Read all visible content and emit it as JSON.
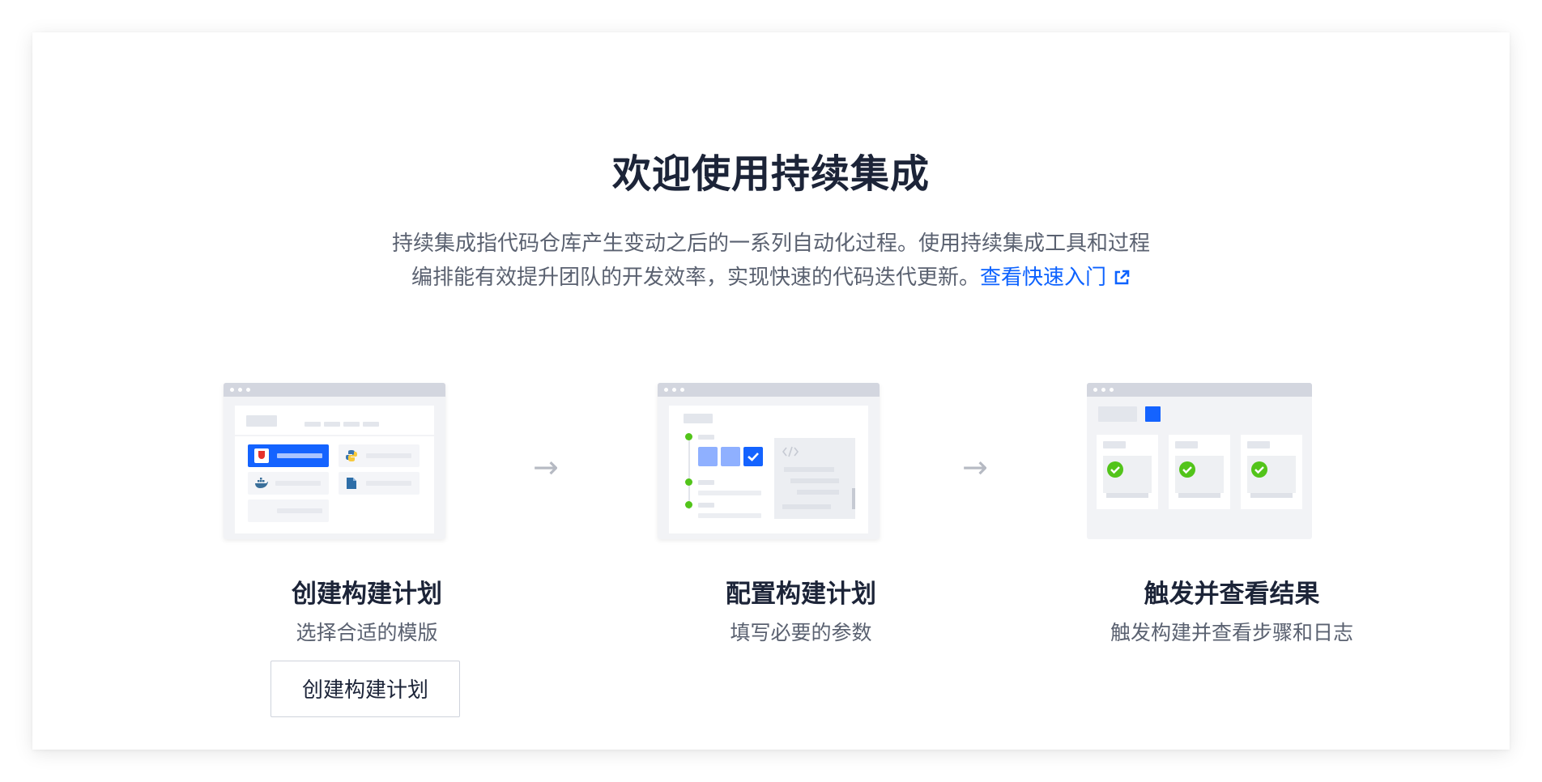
{
  "header": {
    "title": "欢迎使用持续集成",
    "description_line1": "持续集成指代码仓库产生变动之后的一系列自动化过程。使用持续集成工具和过程",
    "description_line2": "编排能有效提升团队的开发效率，实现快速的代码迭代更新。",
    "quickstart_link": "查看快速入门",
    "link_color": "#0c62ff"
  },
  "steps": [
    {
      "title": "创建构建计划",
      "subtitle": "选择合适的模版",
      "icon": "template-picker-illustration"
    },
    {
      "title": "配置构建计划",
      "subtitle": "填写必要的参数",
      "icon": "config-form-illustration"
    },
    {
      "title": "触发并查看结果",
      "subtitle": "触发构建并查看步骤和日志",
      "icon": "build-results-illustration"
    }
  ],
  "actions": {
    "create_button": "创建构建计划"
  },
  "arrow_glyph": "→",
  "colors": {
    "accent": "#1463ff",
    "success": "#52c41a",
    "text_primary": "#1c2438",
    "text_secondary": "#5a6170"
  }
}
